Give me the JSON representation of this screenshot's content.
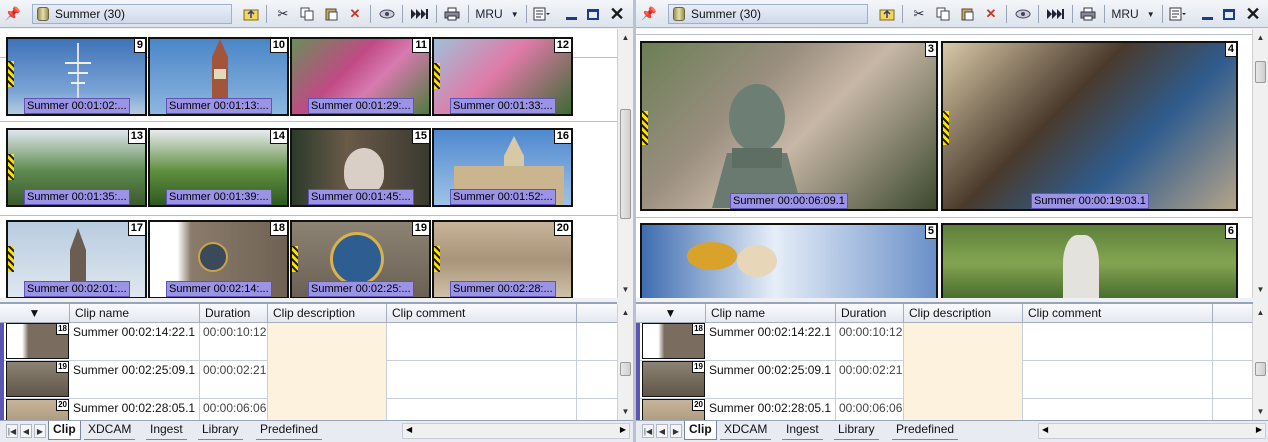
{
  "left": {
    "title": "Summer (30)",
    "mru_label": "MRU",
    "tiles": [
      {
        "num": "9",
        "caption": "Summer 00:01:02:..."
      },
      {
        "num": "10",
        "caption": "Summer 00:01:13:..."
      },
      {
        "num": "11",
        "caption": "Summer 00:01:29:..."
      },
      {
        "num": "12",
        "caption": "Summer 00:01:33:..."
      },
      {
        "num": "13",
        "caption": "Summer 00:01:35:..."
      },
      {
        "num": "14",
        "caption": "Summer 00:01:39:..."
      },
      {
        "num": "15",
        "caption": "Summer 00:01:45:..."
      },
      {
        "num": "16",
        "caption": "Summer 00:01:52:..."
      },
      {
        "num": "17",
        "caption": "Summer 00:02:01:..."
      },
      {
        "num": "18",
        "caption": "Summer 00:02:14:..."
      },
      {
        "num": "19",
        "caption": "Summer 00:02:25:..."
      },
      {
        "num": "20",
        "caption": "Summer 00:02:28:..."
      }
    ]
  },
  "right": {
    "title": "Summer (30)",
    "mru_label": "MRU",
    "tiles": [
      {
        "num": "3",
        "caption": "Summer 00:00:06:09.1"
      },
      {
        "num": "4",
        "caption": "Summer 00:00:19:03.1"
      },
      {
        "num": "5",
        "caption": ""
      },
      {
        "num": "6",
        "caption": ""
      }
    ]
  },
  "grid": {
    "columns": [
      "Clip name",
      "Duration",
      "Clip description",
      "Clip comment"
    ],
    "rows": [
      {
        "num": "18",
        "name": "Summer 00:02:14:22.1",
        "duration": "00:00:10:12",
        "description": "",
        "comment": ""
      },
      {
        "num": "19",
        "name": "Summer 00:02:25:09.1",
        "duration": "00:00:02:21",
        "description": "",
        "comment": ""
      },
      {
        "num": "20",
        "name": "Summer 00:02:28:05.1",
        "duration": "00:00:06:06",
        "description": "",
        "comment": ""
      }
    ]
  },
  "tabs": [
    "Clip",
    "XDCAM",
    "Ingest",
    "Library",
    "Predefined"
  ],
  "active_tab": "Clip",
  "icons": [
    "pin-icon",
    "clip-bin-icon",
    "up-folder-icon",
    "cut-icon",
    "copy-icon",
    "paste-icon",
    "delete-icon",
    "view-icon",
    "play-icon",
    "print-icon",
    "properties-icon",
    "minimize-icon",
    "maximize-icon",
    "close-icon"
  ],
  "colors": {
    "caption_bg": "#9b93e6",
    "description_bg": "#fdf2dd",
    "selection_bar": "#5b55b3"
  }
}
